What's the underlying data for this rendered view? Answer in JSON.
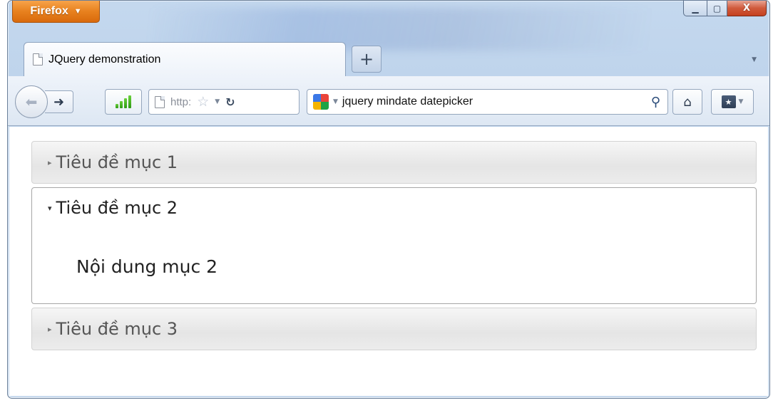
{
  "app_button": {
    "label": "Firefox",
    "caret": "▼"
  },
  "window_controls": {
    "minimize": "▁",
    "maximize": "▢",
    "close": "X"
  },
  "tab": {
    "title": "JQuery demonstration",
    "new_tab": "+"
  },
  "toolbar": {
    "url_text": "http:",
    "search_query": "jquery mindate datepicker"
  },
  "accordion": {
    "sections": [
      {
        "title": "Tiêu đề mục 1",
        "expanded": false
      },
      {
        "title": "Tiêu đề mục 2",
        "expanded": true,
        "content": "Nội dung mục 2"
      },
      {
        "title": "Tiêu đề mục 3",
        "expanded": false
      }
    ]
  },
  "icons": {
    "firefox_menu_caret": "chevron-down-icon",
    "back": "back-arrow-icon",
    "forward": "forward-arrow-icon",
    "signal": "signal-bars-icon",
    "page": "page-icon",
    "bookmark_star": "star-icon",
    "reload": "reload-icon",
    "search_engine": "google-icon",
    "search": "search-icon",
    "home": "home-icon",
    "bookmarks": "bookmarks-icon"
  },
  "colors": {
    "firefox_button": "#e8811e",
    "close_button": "#c5401f",
    "frame": "#b9d0ea",
    "accordion_header": "#e5e5e5",
    "accordion_border": "#a6a6a6"
  }
}
